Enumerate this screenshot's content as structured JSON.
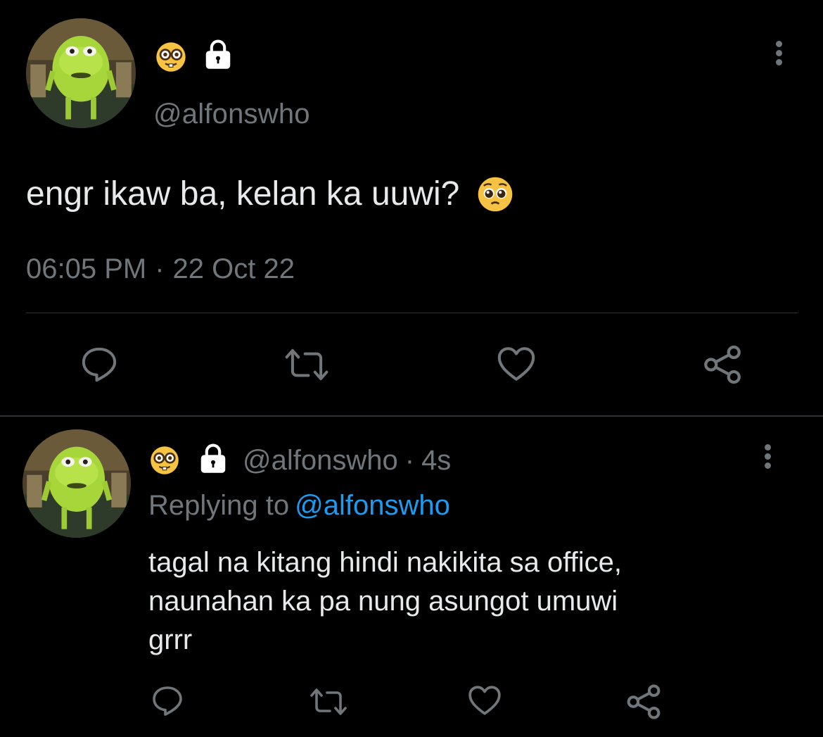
{
  "main_tweet": {
    "avatar": "mike-wazowski-avatar",
    "badges": [
      "nerd-face-emoji",
      "lock-icon"
    ],
    "handle": "@alfonswho",
    "text": "engr ikaw ba, kelan ka uuwi?",
    "text_emoji": "pleading-face-emoji",
    "time": "06:05 PM",
    "separator": "·",
    "date": "22 Oct 22",
    "actions": [
      "reply-icon",
      "retweet-icon",
      "like-icon",
      "share-icon"
    ]
  },
  "reply_tweet": {
    "avatar": "mike-wazowski-avatar",
    "badges": [
      "nerd-face-emoji",
      "lock-icon"
    ],
    "handle": "@alfonswho",
    "separator": "·",
    "age": "4s",
    "replying_label": "Replying to",
    "replying_mention": "@alfonswho",
    "text_lines": [
      "tagal na kitang hindi nakikita sa office,",
      "naunahan ka pa nung asungot umuwi",
      "grrr"
    ],
    "actions": [
      "reply-icon",
      "retweet-icon",
      "like-icon",
      "share-icon"
    ]
  },
  "colors": {
    "background": "#000000",
    "text_primary": "#e7e9ea",
    "text_secondary": "#71767b",
    "link": "#1d9bf0",
    "divider": "#2f3336"
  }
}
